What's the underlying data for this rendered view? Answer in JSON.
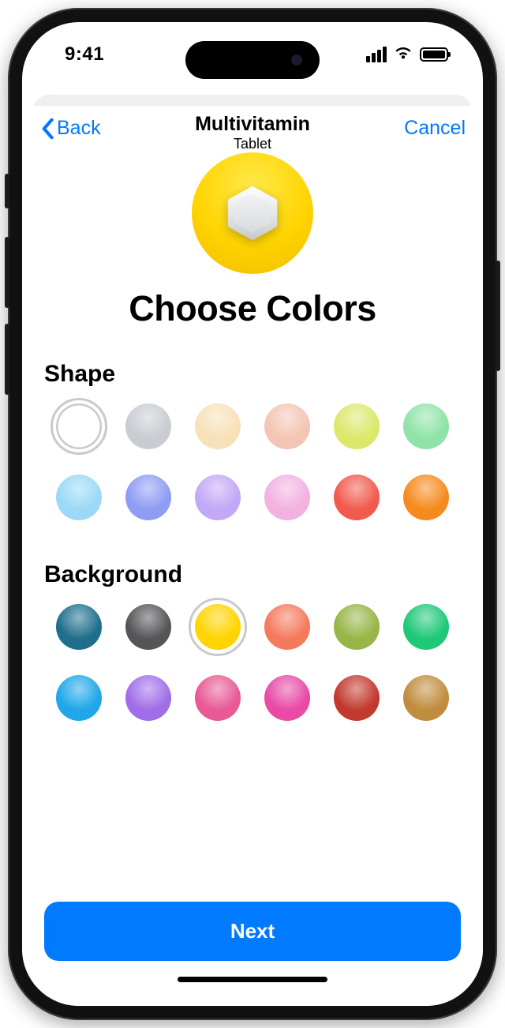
{
  "status": {
    "time": "9:41"
  },
  "nav": {
    "back_label": "Back",
    "title": "Multivitamin",
    "subtitle": "Tablet",
    "cancel_label": "Cancel"
  },
  "heading": "Choose Colors",
  "sections": {
    "shape_label": "Shape",
    "background_label": "Background"
  },
  "shape_colors": [
    {
      "name": "white",
      "hex": "#ffffff",
      "selected": true
    },
    {
      "name": "silver",
      "hex": "#c9cdd2",
      "selected": false
    },
    {
      "name": "cream",
      "hex": "#f7e1b8",
      "selected": false
    },
    {
      "name": "peach",
      "hex": "#f4c5b4",
      "selected": false
    },
    {
      "name": "lime",
      "hex": "#dbe86c",
      "selected": false
    },
    {
      "name": "mint",
      "hex": "#8fe3a8",
      "selected": false
    },
    {
      "name": "sky",
      "hex": "#9bd9f7",
      "selected": false
    },
    {
      "name": "periwinkle",
      "hex": "#8f9cf4",
      "selected": false
    },
    {
      "name": "lavender",
      "hex": "#c3a8f6",
      "selected": false
    },
    {
      "name": "pink",
      "hex": "#f3b1e0",
      "selected": false
    },
    {
      "name": "red",
      "hex": "#f15b4e",
      "selected": false
    },
    {
      "name": "orange",
      "hex": "#f58b1e",
      "selected": false
    }
  ],
  "background_colors": [
    {
      "name": "teal",
      "hex": "#1f6e8c",
      "selected": false
    },
    {
      "name": "charcoal",
      "hex": "#555558",
      "selected": false
    },
    {
      "name": "yellow",
      "hex": "#ffd400",
      "selected": true
    },
    {
      "name": "coral",
      "hex": "#f47a5d",
      "selected": false
    },
    {
      "name": "olive",
      "hex": "#97b647",
      "selected": false
    },
    {
      "name": "green",
      "hex": "#1ec877",
      "selected": false
    },
    {
      "name": "blue",
      "hex": "#1fa7e8",
      "selected": false
    },
    {
      "name": "purple",
      "hex": "#a06ee8",
      "selected": false
    },
    {
      "name": "rose",
      "hex": "#e85a95",
      "selected": false
    },
    {
      "name": "magenta",
      "hex": "#e84aa6",
      "selected": false
    },
    {
      "name": "crimson",
      "hex": "#c23a2e",
      "selected": false
    },
    {
      "name": "bronze",
      "hex": "#c08d3e",
      "selected": false
    }
  ],
  "footer": {
    "next_label": "Next"
  },
  "preview": {
    "background_hex": "#ffd400",
    "shape_hex": "#e8e8e8"
  }
}
